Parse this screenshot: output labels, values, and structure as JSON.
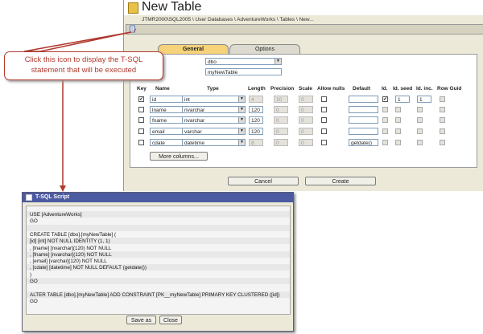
{
  "window": {
    "title": "New Table",
    "breadcrumb": "JTMR2000\\SQL2005 \\ User Databases \\ AdventureWorks \\ Tables \\ New..."
  },
  "tabs": {
    "general": "General",
    "options": "Options"
  },
  "form": {
    "schema": "dbo",
    "table_name": "myNewTable"
  },
  "grid": {
    "headers": [
      "Key",
      "Name",
      "Type",
      "Length",
      "Precision",
      "Scale",
      "Allow nulls",
      "Default",
      "Id.",
      "Id. seed",
      "Id. inc.",
      "Row Guid"
    ],
    "rows": [
      {
        "key": true,
        "name": "id",
        "type": "int",
        "length": "4",
        "precision": "10",
        "scale": "0",
        "allow_nulls": false,
        "default": "",
        "identity": true,
        "seed": "1",
        "inc": "1"
      },
      {
        "key": false,
        "name": "lname",
        "type": "nvarchar",
        "length": "120",
        "precision": "0",
        "scale": "0",
        "allow_nulls": false,
        "default": "",
        "identity": false,
        "seed": "",
        "inc": ""
      },
      {
        "key": false,
        "name": "fname",
        "type": "nvarchar",
        "length": "120",
        "precision": "0",
        "scale": "0",
        "allow_nulls": false,
        "default": "",
        "identity": false,
        "seed": "",
        "inc": ""
      },
      {
        "key": false,
        "name": "email",
        "type": "varchar",
        "length": "120",
        "precision": "0",
        "scale": "0",
        "allow_nulls": false,
        "default": "",
        "identity": false,
        "seed": "",
        "inc": ""
      },
      {
        "key": false,
        "name": "cdate",
        "type": "datetime",
        "length": "8",
        "precision": "0",
        "scale": "0",
        "allow_nulls": false,
        "default": "getdate()",
        "identity": false,
        "seed": "",
        "inc": ""
      }
    ]
  },
  "buttons": {
    "more_columns": "More columns...",
    "cancel": "Cancel",
    "create": "Create"
  },
  "callout": {
    "line1": "Click this icon to display the T-SQL",
    "line2": "statement that will be executed",
    "color": "#b03a2e"
  },
  "tsql": {
    "title": "T-SQL Script",
    "lines": [
      "USE [AdventureWorks]",
      "GO",
      "",
      "CREATE TABLE [dbo].[myNewTable] (",
      "[id] [int] NOT NULL IDENTITY (1, 1)",
      ", [lname] [nvarchar](120) NOT NULL",
      ", [fname] [nvarchar](120) NOT NULL",
      ", [email] [varchar](120) NOT NULL",
      ", [cdate] [datetime] NOT NULL DEFAULT (getdate())",
      ")",
      "GO",
      "",
      "ALTER TABLE [dbo].[myNewTable] ADD CONSTRAINT [PK__myNewTable] PRIMARY KEY CLUSTERED ([id])",
      "GO"
    ],
    "save_as": "Save as",
    "close": "Close"
  },
  "icons": {
    "table": "table-icon",
    "script": "script-icon"
  }
}
